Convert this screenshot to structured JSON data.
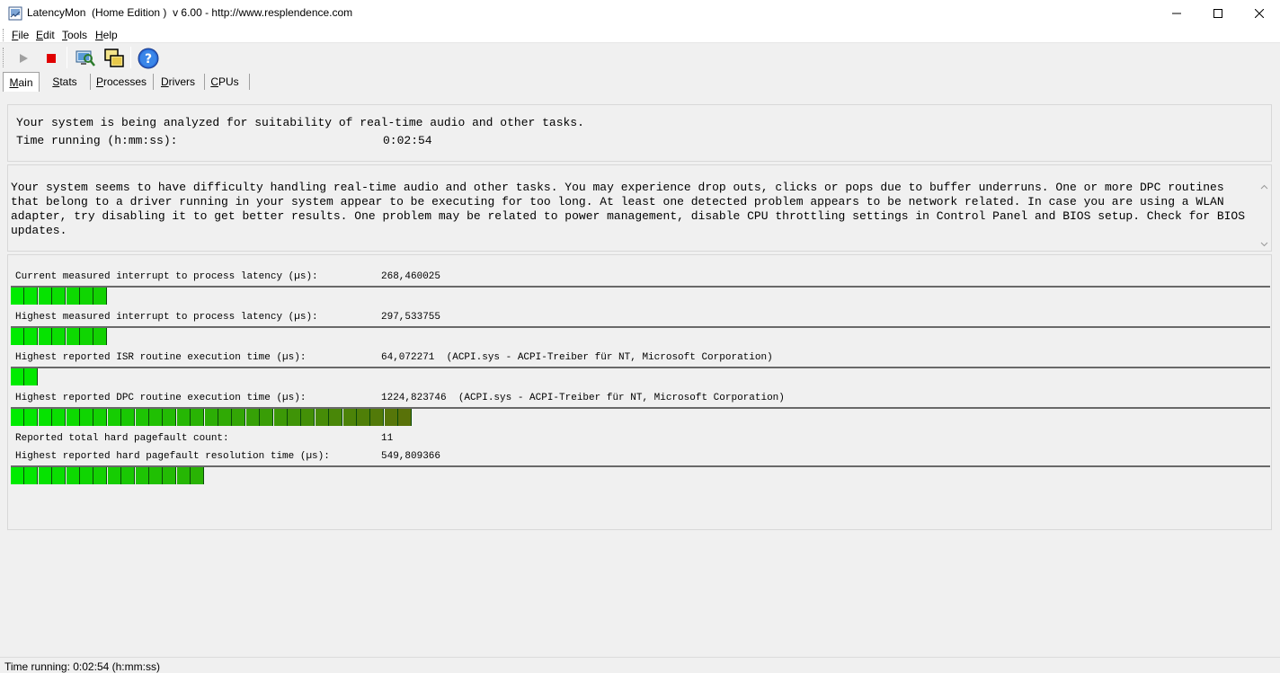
{
  "window": {
    "title": "LatencyMon  (Home Edition )  v 6.00 - http://www.resplendence.com",
    "minimize_icon": "minimize-icon",
    "maximize_icon": "maximize-icon",
    "close_icon": "close-icon"
  },
  "menu": {
    "items": [
      {
        "acc": "F",
        "rest": "ile"
      },
      {
        "acc": "E",
        "rest": "dit"
      },
      {
        "acc": "T",
        "rest": "ools"
      },
      {
        "acc": "H",
        "rest": "elp"
      }
    ]
  },
  "toolbar": {
    "buttons": [
      "play-icon",
      "stop-icon",
      "analyze-icon",
      "windows-icon",
      "help-icon"
    ]
  },
  "tabs": [
    {
      "acc": "M",
      "rest": "ain",
      "active": true
    },
    {
      "acc": "S",
      "rest": "tats"
    },
    {
      "acc": "P",
      "rest": "rocesses"
    },
    {
      "acc": "D",
      "rest": "rivers"
    },
    {
      "acc": "C",
      "rest": "PUs"
    }
  ],
  "status": {
    "analyzing": "Your system is being analyzed for suitability of real-time audio and other tasks.",
    "time_label": "Time running (h:mm:ss):",
    "time_value": "0:02:54"
  },
  "verdict": "Your system seems to have difficulty handling real-time audio and other tasks. You may experience drop outs, clicks or pops due to buffer underruns. One or more DPC routines that belong to a driver running in your system appear to be executing for too long. At least one detected problem appears to be network related. In case you are using a WLAN adapter, try disabling it to get better results. One problem may be related to power management, disable CPU throttling settings in Control Panel and BIOS setup. Check for BIOS updates.",
  "metrics": [
    {
      "label": "Current measured interrupt to process latency (µs):",
      "value": "268,460025",
      "bar_segments": 7
    },
    {
      "label": "Highest measured interrupt to process latency (µs):",
      "value": "297,533755",
      "bar_segments": 7
    },
    {
      "label": "Highest reported ISR routine execution time (µs):",
      "value": "64,072271  (ACPI.sys - ACPI-Treiber für NT, Microsoft Corporation)",
      "bar_segments": 2
    },
    {
      "label": "Highest reported DPC routine execution time (µs):",
      "value": "1224,823746  (ACPI.sys - ACPI-Treiber für NT, Microsoft Corporation)",
      "bar_segments": 29
    },
    {
      "label": "Reported total hard pagefault count:",
      "value": "11"
    },
    {
      "label": "Highest reported hard pagefault resolution time (µs):",
      "value": "549,809366",
      "bar_segments": 14
    }
  ],
  "statusbar": {
    "text": "Time running: 0:02:54  (h:mm:ss)"
  }
}
